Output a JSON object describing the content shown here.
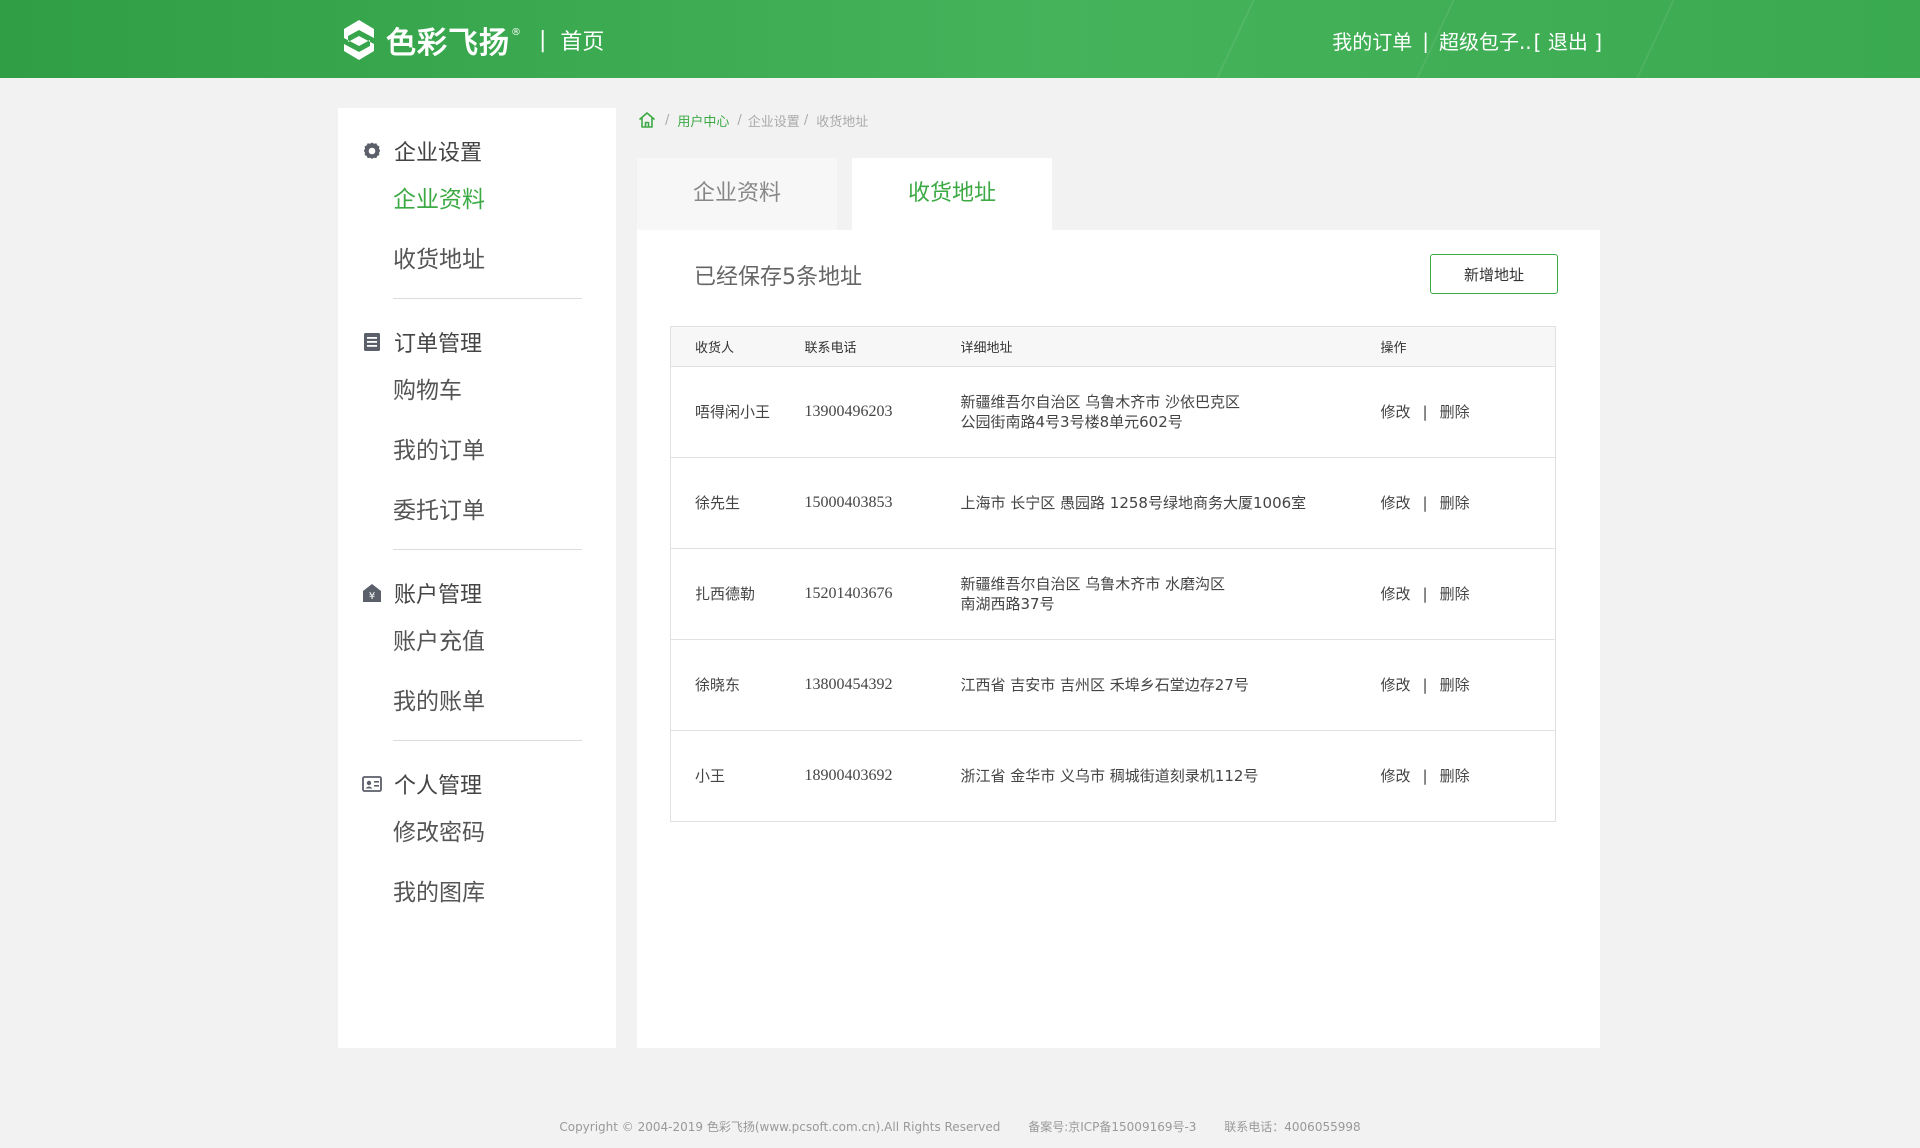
{
  "header": {
    "brand": "色彩飞扬",
    "reg_mark": "®",
    "separator": "|",
    "home_label": "首页",
    "my_orders": "我的订单",
    "bar": "|",
    "user": "超级包子..",
    "logout": "[ 退出 ]",
    "colors": {
      "brand_green": "#3caa44",
      "header_bg": "#3aa94f"
    }
  },
  "sidebar": {
    "groups": [
      {
        "icon": "gear-icon",
        "title": "企业设置",
        "items": [
          "企业资料",
          "收货地址"
        ]
      },
      {
        "icon": "document-list-icon",
        "title": "订单管理",
        "items": [
          "购物车",
          "我的订单",
          "委托订单"
        ]
      },
      {
        "icon": "account-house-icon",
        "title": "账户管理",
        "items": [
          "账户充值",
          "我的账单"
        ]
      },
      {
        "icon": "id-card-icon",
        "title": "个人管理",
        "items": [
          "修改密码",
          "我的图库"
        ]
      }
    ],
    "active_item": "企业资料"
  },
  "breadcrumb": {
    "sep": "/",
    "items": [
      "用户中心",
      "企业设置",
      "收货地址"
    ]
  },
  "tabs": {
    "items": [
      "企业资料",
      "收货地址"
    ],
    "active": "收货地址"
  },
  "address": {
    "summary": "已经保存5条地址",
    "add_button": "新增地址",
    "columns": [
      "收货人",
      "联系电话",
      "详细地址",
      "操作"
    ],
    "edit_label": "修改",
    "pipe": "|",
    "delete_label": "删除",
    "rows": [
      {
        "name": "唔得闲小王",
        "phone": "13900496203",
        "addr1": "新疆维吾尔自治区 乌鲁木齐市 沙依巴克区",
        "addr2": "公园街南路4号3号楼8单元602号"
      },
      {
        "name": "徐先生",
        "phone": "15000403853",
        "addr1": "上海市 长宁区 愚园路 1258号绿地商务大厦1006室",
        "addr2": ""
      },
      {
        "name": "扎西德勒",
        "phone": "15201403676",
        "addr1": "新疆维吾尔自治区 乌鲁木齐市 水磨沟区",
        "addr2": "南湖西路37号"
      },
      {
        "name": "徐晓东",
        "phone": "13800454392",
        "addr1": "江西省 吉安市 吉州区 禾埠乡石堂边存27号",
        "addr2": ""
      },
      {
        "name": "小王",
        "phone": "18900403692",
        "addr1": "浙江省 金华市 义乌市 稠城街道刻录机112号",
        "addr2": ""
      }
    ]
  },
  "footer": {
    "copyright": "Copyright © 2004-2019 色彩飞扬(www.pcsoft.com.cn).All Rights Reserved",
    "icp": "备案号:京ICP备15009169号-3",
    "phone": "联系电话：4006055998"
  }
}
